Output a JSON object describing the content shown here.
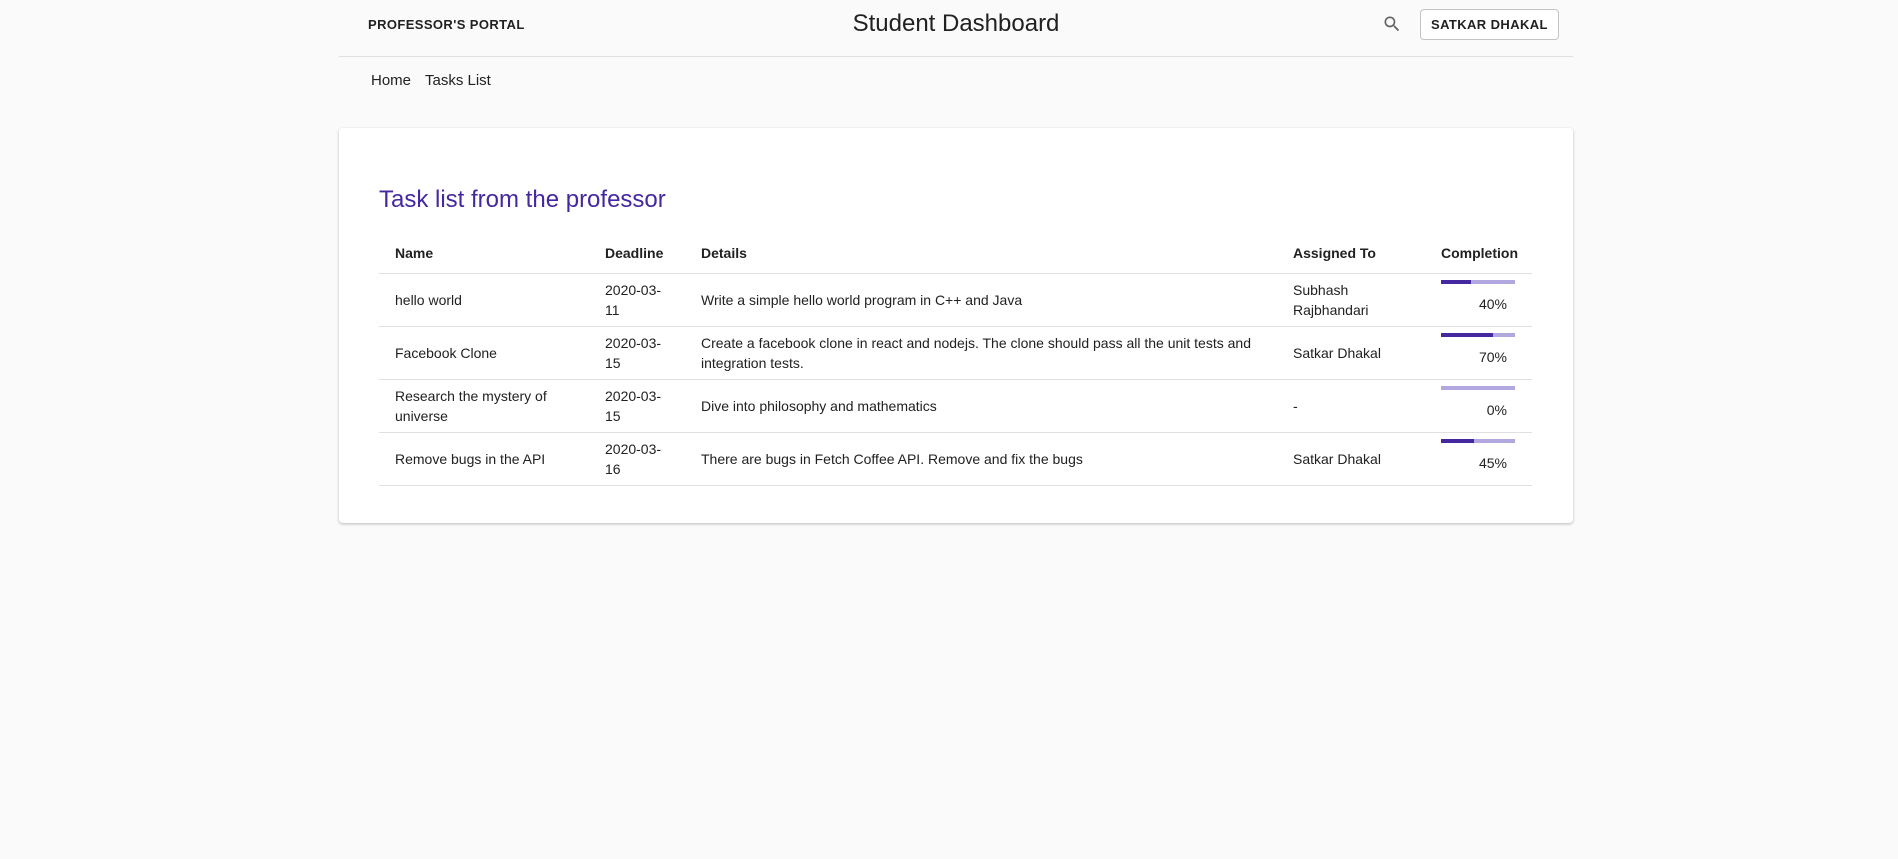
{
  "header": {
    "brand": "PROFESSOR'S PORTAL",
    "title": "Student Dashboard",
    "search_icon": "search-icon",
    "user_button": "SATKAR DHAKAL"
  },
  "nav": {
    "home": "Home",
    "tasks": "Tasks List"
  },
  "card": {
    "title": "Task list from the professor"
  },
  "table": {
    "headers": {
      "name": "Name",
      "deadline": "Deadline",
      "details": "Details",
      "assigned": "Assigned To",
      "completion": "Completion"
    },
    "rows": [
      {
        "name": "hello world",
        "deadline": "2020-03-11",
        "details": "Write a simple hello world program in C++ and Java",
        "assigned": "Subhash Rajbhandari",
        "completion": 40,
        "completion_label": "40%"
      },
      {
        "name": "Facebook Clone",
        "deadline": "2020-03-15",
        "details": "Create a facebook clone in react and nodejs. The clone should pass all the unit tests and integration tests.",
        "assigned": "Satkar Dhakal",
        "completion": 70,
        "completion_label": "70%"
      },
      {
        "name": "Research the mystery of universe",
        "deadline": "2020-03-15",
        "details": "Dive into philosophy and mathematics",
        "assigned": "-",
        "completion": 0,
        "completion_label": "0%"
      },
      {
        "name": "Remove bugs in the API",
        "deadline": "2020-03-16",
        "details": "There are bugs in Fetch Coffee API. Remove and fix the bugs",
        "assigned": "Satkar Dhakal",
        "completion": 45,
        "completion_label": "45%"
      }
    ]
  },
  "colors": {
    "accent": "#4527a0",
    "progress_track": "#b3a7e0",
    "background": "#fafafa"
  }
}
